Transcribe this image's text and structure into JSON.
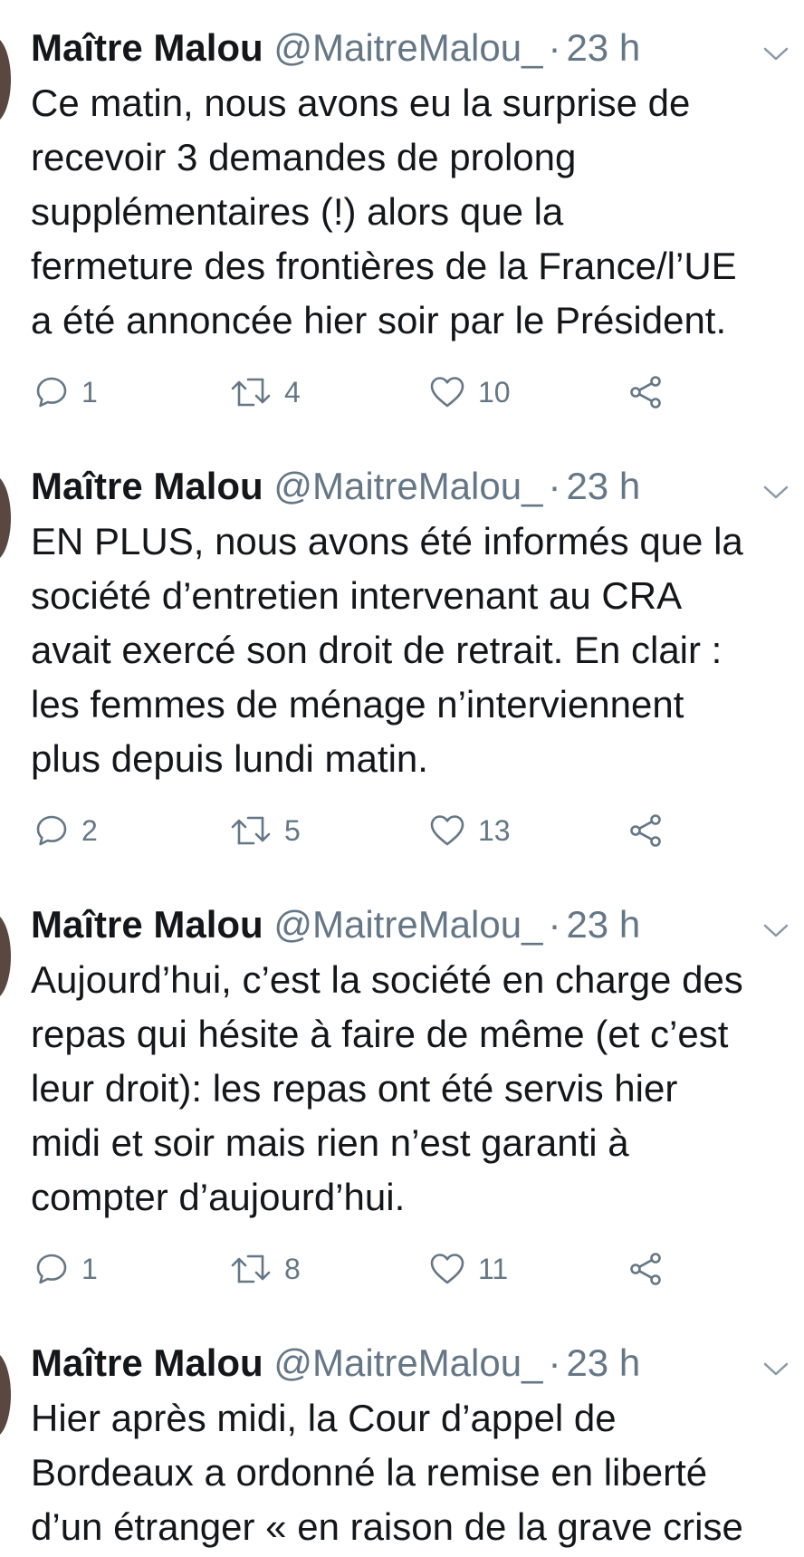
{
  "colors": {
    "text": "#14171a",
    "secondary": "#657786",
    "avatar": "#5a4740"
  },
  "icons": {
    "reply": "reply-icon",
    "retweet": "retweet-icon",
    "like": "heart-icon",
    "share": "share-icon",
    "menu": "chevron-down-icon"
  },
  "tweets": [
    {
      "name": "Maître Malou",
      "handle": "@MaitreMalou_",
      "dot": "·",
      "time": "23 h",
      "lines": [
        "Ce matin, nous avons eu la surprise de",
        "recevoir 3 demandes de prolong",
        "supplémentaires (!) alors que la",
        "fermeture des frontières de la France/l’UE",
        "a été annoncée hier soir par le Président."
      ],
      "replies": "1",
      "retweets": "4",
      "likes": "10"
    },
    {
      "name": "Maître Malou",
      "handle": "@MaitreMalou_",
      "dot": "·",
      "time": "23 h",
      "lines": [
        "EN PLUS, nous avons été informés que la",
        "société d’entretien intervenant au CRA",
        "avait exercé son droit de retrait. En clair :",
        "les femmes de ménage n’interviennent",
        "plus depuis lundi matin."
      ],
      "replies": "2",
      "retweets": "5",
      "likes": "13"
    },
    {
      "name": "Maître Malou",
      "handle": "@MaitreMalou_",
      "dot": "·",
      "time": "23 h",
      "lines": [
        "Aujourd’hui, c’est la société en charge des",
        "repas qui hésite à faire de même (et c’est",
        "leur droit): les repas ont été servis hier",
        "midi et soir mais rien n’est garanti à",
        "compter d’aujourd’hui."
      ],
      "replies": "1",
      "retweets": "8",
      "likes": "11"
    },
    {
      "name": "Maître Malou",
      "handle": "@MaitreMalou_",
      "dot": "·",
      "time": "23 h",
      "lines": [
        "Hier après midi, la Cour d’appel de",
        "Bordeaux a ordonné la remise en liberté",
        "d’un étranger « en raison de la grave crise"
      ]
    }
  ]
}
